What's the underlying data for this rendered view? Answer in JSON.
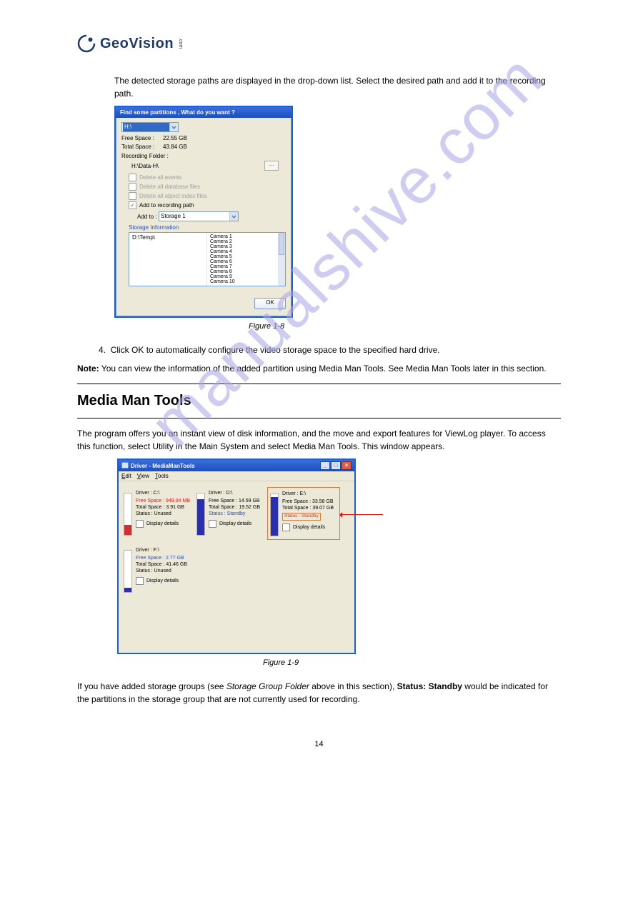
{
  "logo_text": "GeoVision",
  "watermark": "manualshive.com",
  "para1": "The detected storage paths are displayed in the drop-down list. Select the desired path and add it to the recording path.",
  "fig1_caption": "Figure 1-8",
  "item4": "Click OK to automatically configure the video storage space to the specified hard drive.",
  "note_lead": "Note:",
  "note_text": " You can view the information of the added partition using Media Man Tools. See Media Man Tools later in this section.",
  "section_title": "Media Man Tools",
  "para2": "The program offers you an instant view of disk information, and the move and export features for ViewLog player. To access this function, select Utility in the Main System and select Media Man Tools. This window appears.",
  "fig2_caption": "Figure 1-9",
  "para3a": "If you have added storage groups (see ",
  "para3b_italic": "Storage Group Folder",
  "para3c": " above in this section), ",
  "para3d_bold": "Status: Standby",
  "para3e": " would be indicated for the partitions in the storage group that are not currently used for recording.",
  "page_number": "14",
  "dlg1": {
    "title": "Find some partitions , What do you want ?",
    "drive_sel": "H:\\",
    "free_space_lbl": "Free Space :",
    "free_space_val": "22.55 GB",
    "total_space_lbl": "Total Space :",
    "total_space_val": "43.84 GB",
    "rec_folder_lbl": "Recording Folder :",
    "rec_folder_path": "H:\\Data-H\\",
    "del_events": "Delete all events",
    "del_db": "Delete all database files",
    "del_obj": "Delete all object index files",
    "add_path": "Add to recording path",
    "addto_lbl": "Add to :",
    "addto_val": "Storage 1",
    "storage_info": "Storage Information",
    "left_item": "D:\\Temp\\",
    "cams": [
      "Camera 1",
      "Camera 2",
      "Camera 3",
      "Camera 4",
      "Camera 5",
      "Camera 6",
      "Camera 7",
      "Camera 8",
      "Camera 9",
      "Camera 10"
    ],
    "ok": "OK"
  },
  "drv": {
    "win_title": "Driver - MediaManTools",
    "menu": {
      "edit": "Edit",
      "view": "View",
      "tools": "Tools"
    },
    "disp_details": "Display details",
    "cards": [
      {
        "drive": "Driver : C:\\",
        "free": "Free Space : 949.04 MB",
        "free_cls": "red",
        "total": "Total Space : 3.91 GB",
        "status": "Status : Unused",
        "status_cls": "",
        "fill_h": "14",
        "fill_color": "#d03030"
      },
      {
        "drive": "Driver : D:\\",
        "free": "Free Space : 14.59 GB",
        "free_cls": "",
        "total": "Total Space : 19.52 GB",
        "status": "Status : Standby",
        "status_cls": "blue",
        "fill_h": "50",
        "fill_color": "#2a2fb0"
      },
      {
        "drive": "Driver : E:\\",
        "free": "Free Space : 33.58 GB",
        "free_cls": "",
        "total": "Total Space : 39.07 GB",
        "status_box": "Status : Standby",
        "fill_h": "54",
        "fill_color": "#2a2fb0",
        "highlight": true
      },
      {
        "drive": "Driver : F:\\",
        "free": "Free Space : 2.77 GB",
        "free_cls": "blue",
        "total": "Total Space : 41.46 GB",
        "status": "Status : Unused",
        "status_cls": "",
        "fill_h": "6",
        "fill_color": "#2a2fb0"
      }
    ]
  }
}
